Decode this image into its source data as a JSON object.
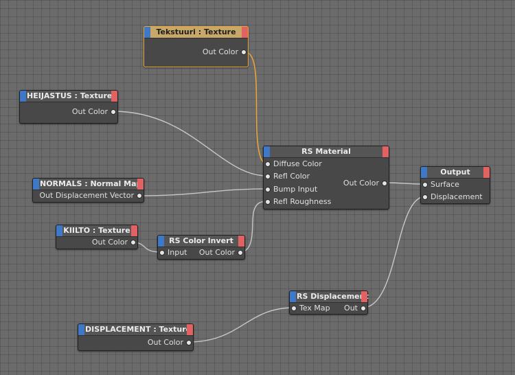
{
  "nodes": {
    "tekstuuri": {
      "title": "Tekstuuri : Texture",
      "out": "Out Color"
    },
    "heijastus": {
      "title": "HEIJASTUS : Texture",
      "out": "Out Color"
    },
    "normals": {
      "title": "NORMALS : Normal Map",
      "out": "Out Displacement Vector"
    },
    "kiilto": {
      "title": "KIILTO : Texture",
      "out": "Out Color"
    },
    "invert": {
      "title": "RS Color Invert",
      "in": "Input",
      "out": "Out Color"
    },
    "material": {
      "title": "RS Material",
      "inputs": [
        "Diffuse Color",
        "Refl Color",
        "Bump Input",
        "Refl Roughness"
      ],
      "out": "Out Color"
    },
    "output": {
      "title": "Output",
      "inputs": [
        "Surface",
        "Displacement"
      ]
    },
    "rsdisp": {
      "title": "RS Displacement",
      "in": "Tex Map",
      "out": "Out"
    },
    "displacement": {
      "title": "DISPLACEMENT : Texture",
      "out": "Out Color"
    }
  },
  "colors": {
    "canvas": "#6b6b6b",
    "node_body": "#484848",
    "header_left_accent": "#3f78c6",
    "header_right_accent": "#e06262",
    "selected_header": "#c7a868",
    "selected_wire": "#e8a53a",
    "wire": "#c8c8c8"
  }
}
